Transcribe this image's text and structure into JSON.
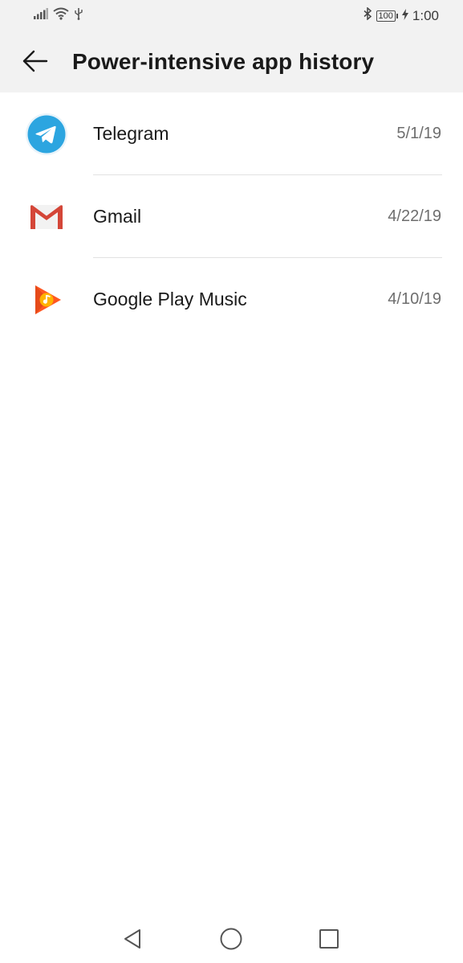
{
  "status_bar": {
    "time": "1:00",
    "battery_level": "100",
    "icons": [
      "signal-icon",
      "wifi-icon",
      "usb-icon",
      "bluetooth-icon",
      "battery-icon",
      "charging-icon"
    ]
  },
  "header": {
    "title": "Power-intensive app history",
    "back_icon": "arrow-left-icon"
  },
  "apps": [
    {
      "name": "Telegram",
      "date": "5/1/19",
      "icon": "telegram-icon"
    },
    {
      "name": "Gmail",
      "date": "4/22/19",
      "icon": "gmail-icon"
    },
    {
      "name": "Google Play Music",
      "date": "4/10/19",
      "icon": "google-play-music-icon"
    }
  ],
  "nav_bar": {
    "icons": [
      "nav-back-icon",
      "nav-home-icon",
      "nav-recents-icon"
    ]
  },
  "colors": {
    "header_bg": "#f2f2f2",
    "telegram_blue": "#2ca5e0",
    "gmail_red": "#d44638",
    "play_music_orange": "#ff5722",
    "divider": "#e2e2e2"
  }
}
